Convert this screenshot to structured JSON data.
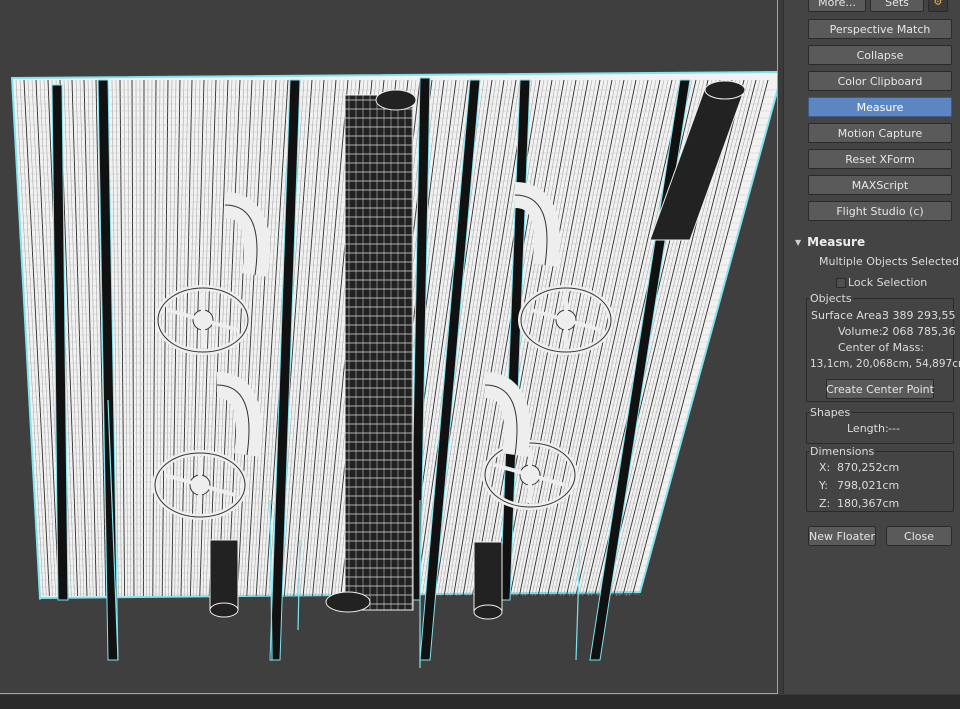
{
  "utilities": {
    "top_buttons": {
      "more_label": "More...",
      "sets_label": "Sets"
    },
    "buttons": [
      {
        "label": "Perspective Match",
        "active": false
      },
      {
        "label": "Collapse",
        "active": false
      },
      {
        "label": "Color Clipboard",
        "active": false
      },
      {
        "label": "Measure",
        "active": true
      },
      {
        "label": "Motion Capture",
        "active": false
      },
      {
        "label": "Reset XForm",
        "active": false
      },
      {
        "label": "MAXScript",
        "active": false
      },
      {
        "label": "Flight Studio (c)",
        "active": false
      }
    ]
  },
  "measure": {
    "title": "Measure",
    "selection_status": "Multiple Objects Selected",
    "lock_selection_label": "Lock Selection",
    "objects": {
      "group_label": "Objects",
      "surface_area_label": "Surface Area:",
      "surface_area_value": "3 389 293,55",
      "volume_label": "Volume:",
      "volume_value": "2 068 785,36",
      "center_of_mass_label": "Center of Mass:",
      "center_of_mass_value": "13,1cm, 20,068cm, 54,897cn",
      "create_center_point_label": "Create Center Point"
    },
    "shapes": {
      "group_label": "Shapes",
      "length_label": "Length:",
      "length_value": "---"
    },
    "dimensions": {
      "group_label": "Dimensions",
      "x_label": "X:",
      "x_value": "870,252cm",
      "y_label": "Y:",
      "y_value": "798,021cm",
      "z_label": "Z:",
      "z_value": "180,367cm"
    },
    "new_floater_label": "New Floater",
    "close_label": "Close"
  },
  "colors": {
    "accent": "#5b86c2",
    "viewport_border": "#c8a24a",
    "selection_wire": "#7fe3f0"
  }
}
